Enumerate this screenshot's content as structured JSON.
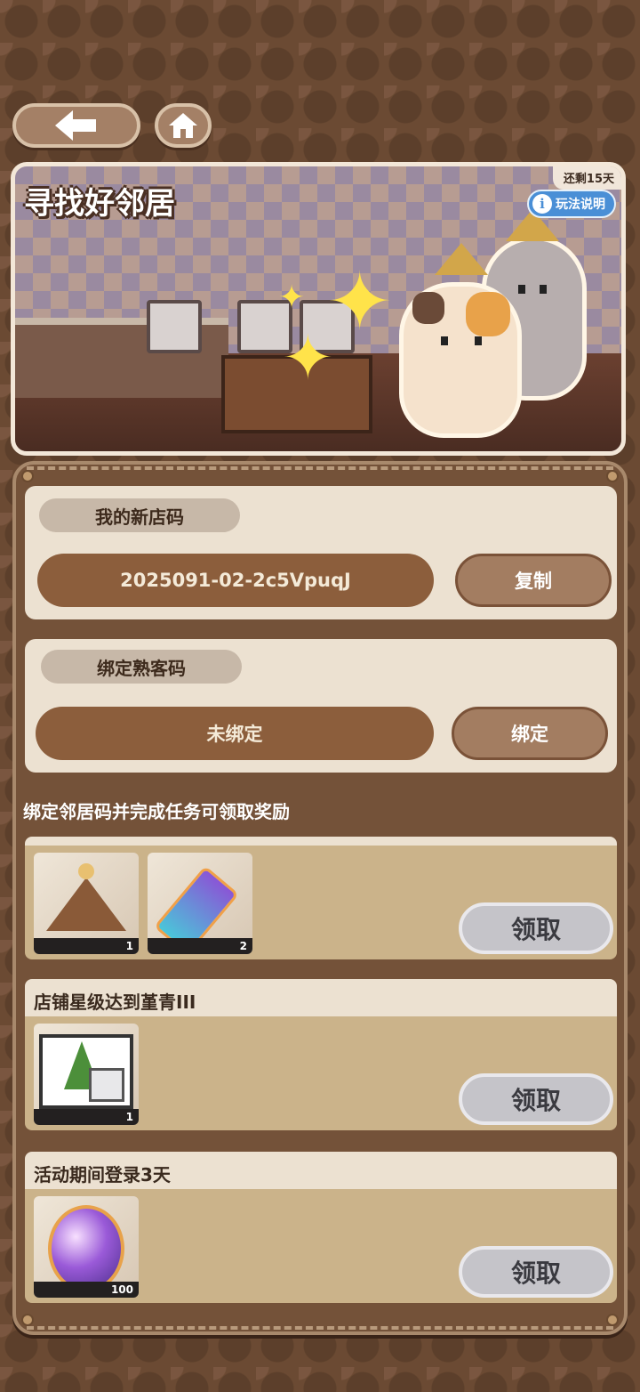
{
  "nav": {
    "back_icon": "arrow-left-icon",
    "home_icon": "home-icon"
  },
  "banner": {
    "title": "寻找好邻居",
    "remaining": "还剩15天",
    "rules_label": "玩法说明"
  },
  "shop_code": {
    "label": "我的新店码",
    "value": "2025091-02-2c5VpuqJ",
    "button": "复制"
  },
  "bind_code": {
    "label": "绑定熟客码",
    "value": "未绑定",
    "button": "绑定"
  },
  "section_heading": "绑定邻居码并完成任务可领取奖励",
  "tasks": [
    {
      "title": "",
      "rewards": [
        {
          "icon": "crown-icon",
          "count": "1"
        },
        {
          "icon": "ticket-icon",
          "count": "2"
        }
      ],
      "claim": "领取"
    },
    {
      "title": "店铺星级达到堇青III",
      "rewards": [
        {
          "icon": "furniture-icon",
          "count": "1"
        }
      ],
      "claim": "领取"
    },
    {
      "title": "活动期间登录3天",
      "rewards": [
        {
          "icon": "gem-egg-icon",
          "count": "100"
        }
      ],
      "claim": "领取"
    }
  ],
  "colors": {
    "accent_brown": "#8c5e3c",
    "card_bg": "#ece1d1",
    "info_blue": "#4a8fd6"
  }
}
